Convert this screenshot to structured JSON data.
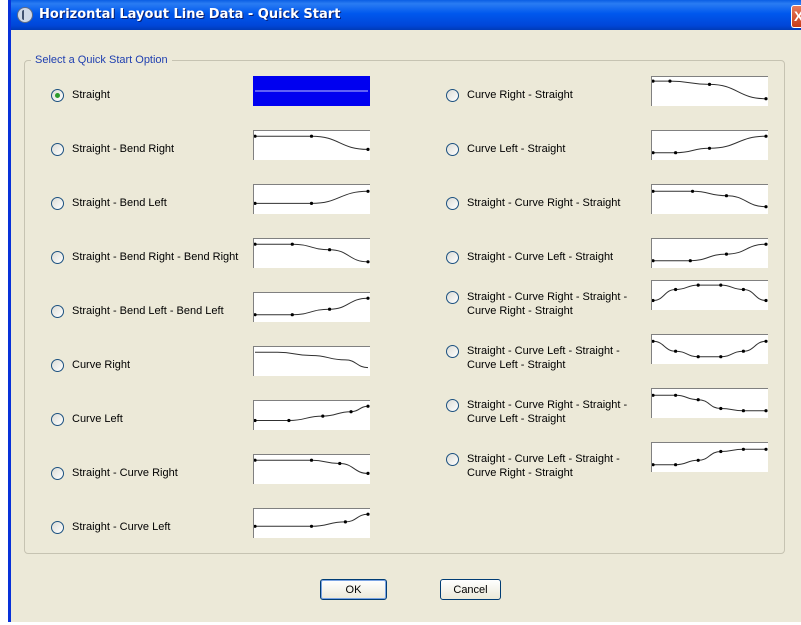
{
  "window": {
    "title": "Horizontal Layout Line Data - Quick Start",
    "close_glyph": "X"
  },
  "group": {
    "label": "Select a Quick Start Option"
  },
  "options": [
    {
      "label": "Straight",
      "selected": true,
      "pts": [
        [
          0,
          0.5
        ],
        [
          1,
          0.5
        ]
      ],
      "dots": false
    },
    {
      "label": "Straight - Bend Right",
      "selected": false,
      "pts": [
        [
          0,
          0.1
        ],
        [
          0.5,
          0.1
        ],
        [
          1,
          0.7
        ]
      ],
      "dots": true
    },
    {
      "label": "Straight - Bend Left",
      "selected": false,
      "pts": [
        [
          0,
          0.7
        ],
        [
          0.5,
          0.7
        ],
        [
          1,
          0.15
        ]
      ],
      "dots": true
    },
    {
      "label": "Straight - Bend Right - Bend Right",
      "selected": false,
      "pts": [
        [
          0,
          0.1
        ],
        [
          0.33,
          0.1
        ],
        [
          0.66,
          0.35
        ],
        [
          1,
          0.9
        ]
      ],
      "dots": true
    },
    {
      "label": "Straight - Bend Left - Bend Left",
      "selected": false,
      "pts": [
        [
          0,
          0.85
        ],
        [
          0.33,
          0.85
        ],
        [
          0.66,
          0.6
        ],
        [
          1,
          0.1
        ]
      ],
      "dots": true
    },
    {
      "label": "Curve Right",
      "selected": false,
      "pts": [
        [
          0,
          0.1
        ],
        [
          0.2,
          0.1
        ],
        [
          0.5,
          0.25
        ],
        [
          0.8,
          0.45
        ],
        [
          1,
          0.8
        ]
      ],
      "dots": false
    },
    {
      "label": "Curve Left",
      "selected": false,
      "pts": [
        [
          0,
          0.75
        ],
        [
          0.3,
          0.75
        ],
        [
          0.6,
          0.55
        ],
        [
          0.85,
          0.35
        ],
        [
          1,
          0.1
        ]
      ],
      "dots": true
    },
    {
      "label": "Straight - Curve Right",
      "selected": false,
      "pts": [
        [
          0,
          0.1
        ],
        [
          0.5,
          0.1
        ],
        [
          0.75,
          0.25
        ],
        [
          1,
          0.7
        ]
      ],
      "dots": true
    },
    {
      "label": "Straight - Curve Left",
      "selected": false,
      "pts": [
        [
          0,
          0.65
        ],
        [
          0.5,
          0.65
        ],
        [
          0.8,
          0.45
        ],
        [
          1,
          0.1
        ]
      ],
      "dots": true
    },
    {
      "label": "Curve Right - Straight",
      "selected": false,
      "pts": [
        [
          0,
          0.05
        ],
        [
          0.15,
          0.05
        ],
        [
          0.5,
          0.2
        ],
        [
          1,
          0.85
        ]
      ],
      "dots": true
    },
    {
      "label": "Curve Left - Straight",
      "selected": false,
      "pts": [
        [
          0,
          0.85
        ],
        [
          0.2,
          0.85
        ],
        [
          0.5,
          0.65
        ],
        [
          1,
          0.1
        ]
      ],
      "dots": true
    },
    {
      "label": "Straight - Curve Right - Straight",
      "selected": false,
      "pts": [
        [
          0,
          0.15
        ],
        [
          0.35,
          0.15
        ],
        [
          0.65,
          0.35
        ],
        [
          1,
          0.85
        ]
      ],
      "dots": true
    },
    {
      "label": "Straight - Curve Left - Straight",
      "selected": false,
      "pts": [
        [
          0,
          0.85
        ],
        [
          0.33,
          0.85
        ],
        [
          0.65,
          0.55
        ],
        [
          1,
          0.1
        ]
      ],
      "dots": true
    },
    {
      "label": "Straight - Curve Right - Straight -\nCurve Right - Straight",
      "selected": false,
      "pts": [
        [
          0,
          0.75
        ],
        [
          0.2,
          0.25
        ],
        [
          0.4,
          0.05
        ],
        [
          0.6,
          0.05
        ],
        [
          0.8,
          0.25
        ],
        [
          1,
          0.75
        ]
      ],
      "dots": true
    },
    {
      "label": "Straight - Curve Left - Straight -\nCurve Left - Straight",
      "selected": false,
      "pts": [
        [
          0,
          0.15
        ],
        [
          0.2,
          0.6
        ],
        [
          0.4,
          0.85
        ],
        [
          0.6,
          0.85
        ],
        [
          0.8,
          0.6
        ],
        [
          1,
          0.15
        ]
      ],
      "dots": true
    },
    {
      "label": "Straight - Curve Right - Straight -\nCurve Left - Straight",
      "selected": false,
      "pts": [
        [
          0,
          0.15
        ],
        [
          0.2,
          0.15
        ],
        [
          0.4,
          0.35
        ],
        [
          0.6,
          0.75
        ],
        [
          0.8,
          0.85
        ],
        [
          1,
          0.85
        ]
      ],
      "dots": true
    },
    {
      "label": "Straight - Curve Left - Straight -\nCurve Right - Straight",
      "selected": false,
      "pts": [
        [
          0,
          0.85
        ],
        [
          0.2,
          0.85
        ],
        [
          0.4,
          0.65
        ],
        [
          0.6,
          0.25
        ],
        [
          0.8,
          0.15
        ],
        [
          1,
          0.15
        ]
      ],
      "dots": true
    }
  ],
  "buttons": {
    "ok": "OK",
    "cancel": "Cancel"
  }
}
